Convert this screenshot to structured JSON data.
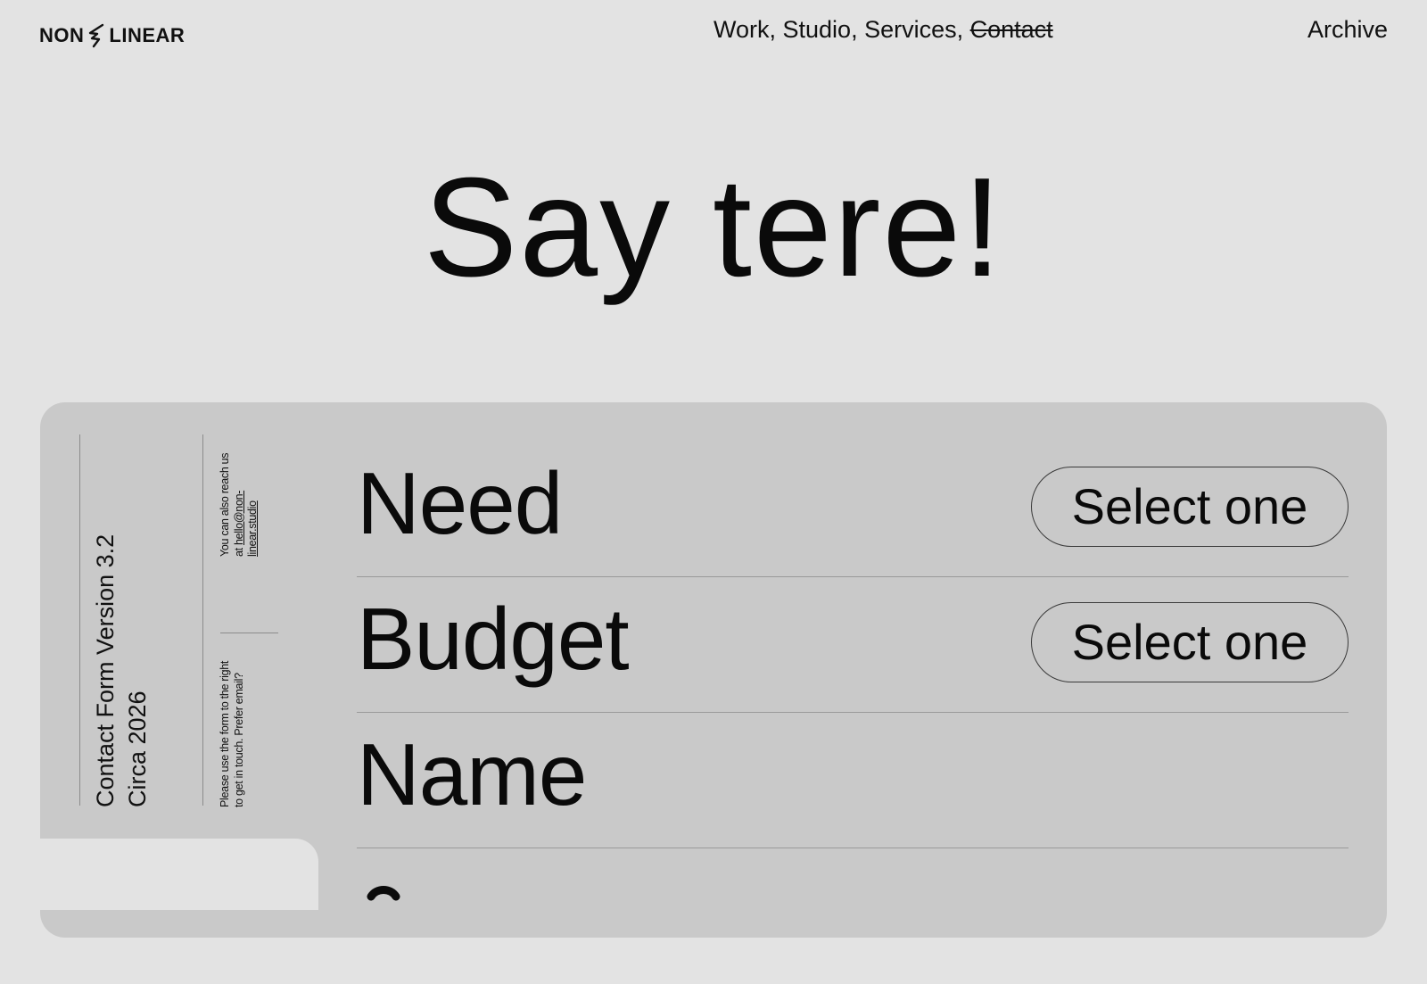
{
  "header": {
    "logo": {
      "left": "NON",
      "right": "LINEAR",
      "mark": "bolt-mark-icon"
    },
    "nav": [
      {
        "label": "Work, ",
        "active": false
      },
      {
        "label": "Studio, ",
        "active": false
      },
      {
        "label": "Services, ",
        "active": false
      },
      {
        "label": "Contact",
        "active": true
      }
    ],
    "archive": "Archive"
  },
  "hero": {
    "title": "Say tere!"
  },
  "sidebar": {
    "version_line1": "Contact Form Version 3.2",
    "version_line2": "Circa 2026",
    "reach_prefix_1": "You can also reach us",
    "reach_prefix_2": "at ",
    "reach_email_part1": "hello@non-",
    "reach_email_part2": "linear.studio",
    "please_line1": "Please use the form to the right",
    "please_line2": "to get in touch. Prefer email?"
  },
  "form": {
    "rows": [
      {
        "label": "Need",
        "select": "Select one"
      },
      {
        "label": "Budget",
        "select": "Select one"
      },
      {
        "label": "Name"
      }
    ]
  },
  "colors": {
    "page_bg": "#e3e3e3",
    "card_bg": "#c9c9c9",
    "text": "#0a0a0a"
  }
}
